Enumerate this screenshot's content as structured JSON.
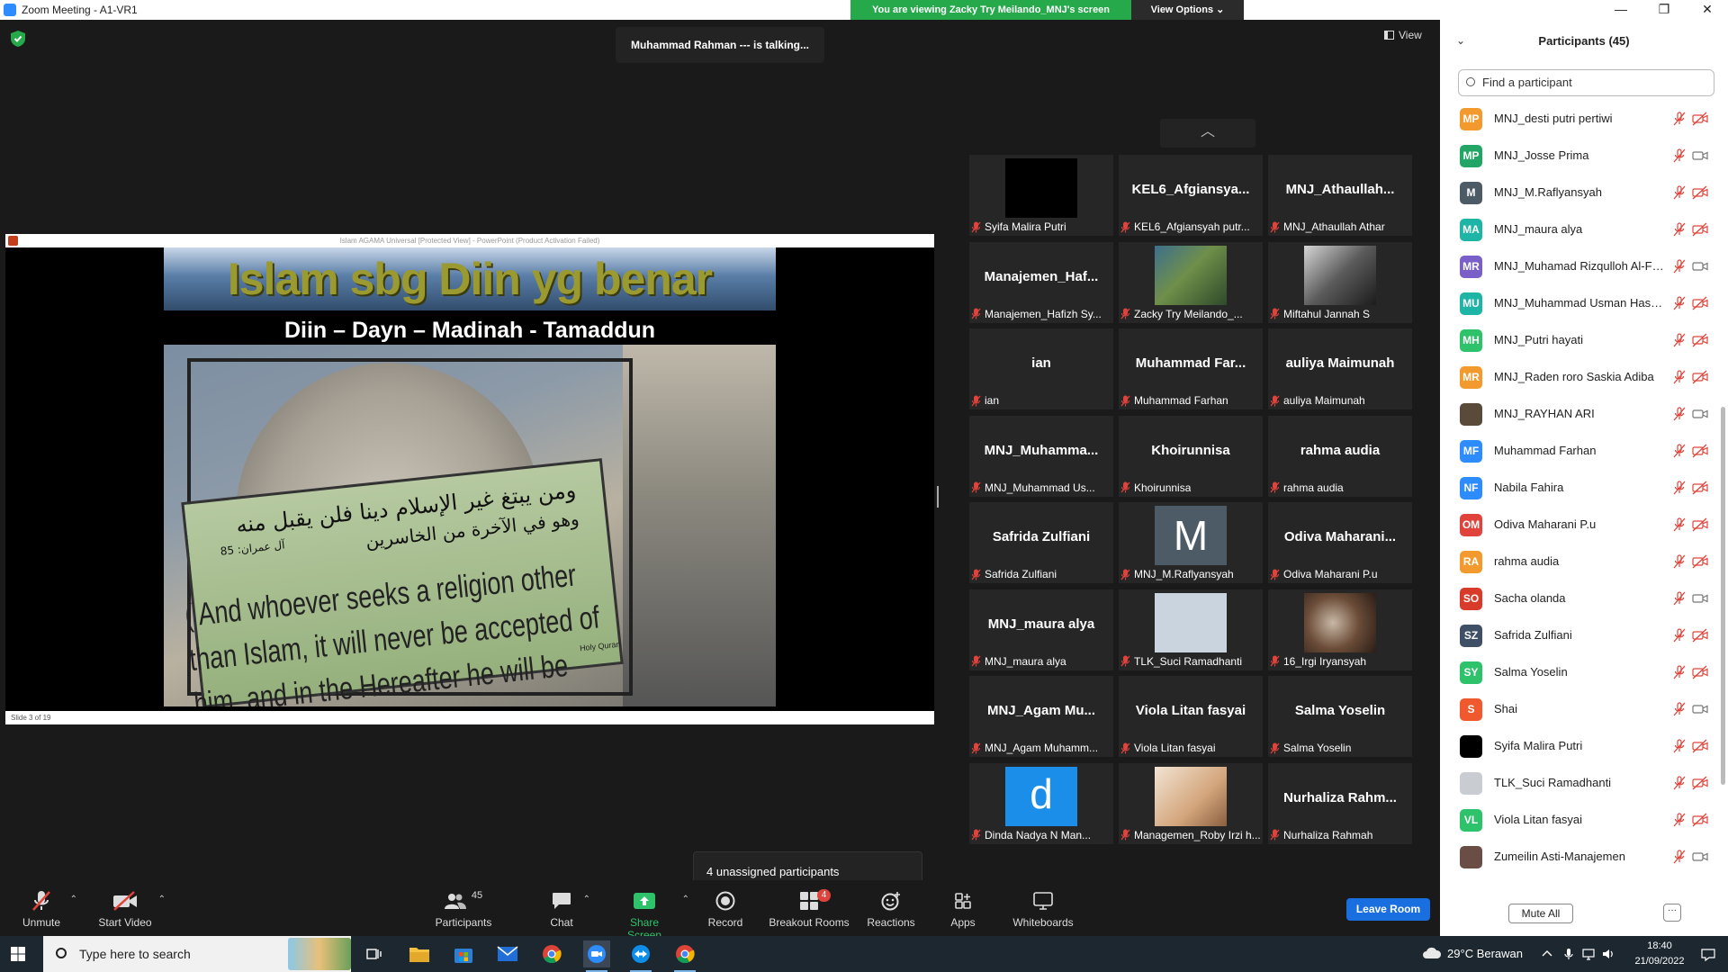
{
  "window": {
    "title": "Zoom Meeting - A1-VR1",
    "banner_text": "You are viewing Zacky Try Meilando_MNJ's screen",
    "view_options_label": "View Options ⌄",
    "controls": [
      "—",
      "❐",
      "✕"
    ]
  },
  "meeting": {
    "talking_text": "Muhammad Rahman --- is talking...",
    "view_label": "View",
    "unassigned_text": "4 unassigned participants"
  },
  "shared_screen": {
    "ppt_titlebar": "Islam AGAMA Universal [Protected View] - PowerPoint (Product Activation Failed)",
    "slide_status": "Slide 3 of 19",
    "slide_title": "Islam sbg Diin yg benar",
    "slide_subtitle": "Diin – Dayn – Madinah - Tamaddun",
    "arabic_line1": "ومن يبتغ غير الإسلام دينا فلن يقبل منه",
    "arabic_line2": "وهو في الآخرة من الخاسرين",
    "english_text": "( And whoever seeks a religion other than Islam, it will never be accepted of him, and in the Hereafter he will be one of the losers )",
    "sign_source": "Holy Quran",
    "verse_ref": "آل عمران: 85"
  },
  "gallery": {
    "tiles": [
      {
        "name": "",
        "caption": "Syifa Malira Putri",
        "pic": "black"
      },
      {
        "name": "KEL6_Afgiansya...",
        "caption": "KEL6_Afgiansyah putr...",
        "pic": ""
      },
      {
        "name": "MNJ_Athaullah...",
        "caption": "MNJ_Athaullah Athar",
        "pic": ""
      },
      {
        "name": "Manajemen_Haf...",
        "caption": "Manajemen_Hafizh Sy...",
        "pic": ""
      },
      {
        "name": "",
        "caption": "Zacky Try Meilando_...",
        "pic": "photo-green"
      },
      {
        "name": "",
        "caption": "Miftahul Jannah S",
        "pic": "photo-gray"
      },
      {
        "name": "ian",
        "caption": "ian",
        "pic": ""
      },
      {
        "name": "Muhammad Far...",
        "caption": "Muhammad Farhan",
        "pic": ""
      },
      {
        "name": "auliya Maimunah",
        "caption": "auliya Maimunah",
        "pic": ""
      },
      {
        "name": "MNJ_Muhamma...",
        "caption": "MNJ_Muhammad Us...",
        "pic": ""
      },
      {
        "name": "Khoirunnisa",
        "caption": "Khoirunnisa",
        "pic": ""
      },
      {
        "name": "rahma audia",
        "caption": "rahma audia",
        "pic": ""
      },
      {
        "name": "Safrida Zulfiani",
        "caption": "Safrida Zulfiani",
        "pic": ""
      },
      {
        "name": "",
        "caption": "MNJ_M.Raflyansyah",
        "pic": "letter-M"
      },
      {
        "name": "Odiva  Maharani...",
        "caption": "Odiva Maharani P.u",
        "pic": ""
      },
      {
        "name": "MNJ_maura alya",
        "caption": "MNJ_maura alya",
        "pic": ""
      },
      {
        "name": "",
        "caption": "TLK_Suci Ramadhanti",
        "pic": "light-blue"
      },
      {
        "name": "",
        "caption": "16_Irgi Iryansyah",
        "pic": "photo-brown"
      },
      {
        "name": "MNJ_Agam  Mu...",
        "caption": "MNJ_Agam Muhamm...",
        "pic": ""
      },
      {
        "name": "Viola Litan fasyai",
        "caption": "Viola Litan fasyai",
        "pic": ""
      },
      {
        "name": "Salma Yoselin",
        "caption": "Salma Yoselin",
        "pic": ""
      },
      {
        "name": "",
        "caption": "Dinda Nadya N Man...",
        "pic": "letter-d"
      },
      {
        "name": "",
        "caption": "Managemen_Roby Irzi h...",
        "pic": "photo-cream"
      },
      {
        "name": "Nurhaliza  Rahm...",
        "caption": "Nurhaliza Rahmah",
        "pic": ""
      }
    ],
    "pic_letters": {
      "letter-M": "M",
      "letter-d": "d"
    }
  },
  "toolbar": {
    "unmute": "Unmute",
    "start_video": "Start Video",
    "participants": "Participants",
    "participants_count": "45",
    "chat": "Chat",
    "share_screen": "Share Screen",
    "record": "Record",
    "breakout_rooms": "Breakout Rooms",
    "breakout_badge": "4",
    "reactions": "Reactions",
    "apps": "Apps",
    "whiteboards": "Whiteboards",
    "leave_room": "Leave Room"
  },
  "participants_panel": {
    "title": "Participants (45)",
    "search_placeholder": "Find a participant",
    "mute_all": "Mute All",
    "more_label": "···",
    "items": [
      {
        "initials": "MP",
        "color": "#f29a2e",
        "name": "MNJ_desti putri pertiwi",
        "video": "off"
      },
      {
        "initials": "MP",
        "color": "#23a566",
        "name": "MNJ_Josse Prima",
        "video": "on"
      },
      {
        "initials": "M",
        "color": "#4d5b67",
        "name": "MNJ_M.Raflyansyah",
        "video": "off"
      },
      {
        "initials": "MA",
        "color": "#1fb5a6",
        "name": "MNJ_maura alya",
        "video": "off"
      },
      {
        "initials": "MR",
        "color": "#7b5fc9",
        "name": "MNJ_Muhamad Rizqulloh Al-Fa...",
        "video": "on"
      },
      {
        "initials": "MU",
        "color": "#1fb5a6",
        "name": "MNJ_Muhammad Usman Hasa...",
        "video": "off"
      },
      {
        "initials": "MH",
        "color": "#2ec26b",
        "name": "MNJ_Putri hayati",
        "video": "off"
      },
      {
        "initials": "MR",
        "color": "#f29a2e",
        "name": "MNJ_Raden roro Saskia Adiba",
        "video": "off"
      },
      {
        "initials": "",
        "color": "#5a4a3a",
        "name": "MNJ_RAYHAN ARI",
        "video": "on"
      },
      {
        "initials": "MF",
        "color": "#2d8cff",
        "name": "Muhammad Farhan",
        "video": "off"
      },
      {
        "initials": "NF",
        "color": "#2d8cff",
        "name": "Nabila Fahira",
        "video": "off"
      },
      {
        "initials": "OM",
        "color": "#e0433b",
        "name": "Odiva Maharani P.u",
        "video": "off"
      },
      {
        "initials": "RA",
        "color": "#f29a2e",
        "name": "rahma audia",
        "video": "off"
      },
      {
        "initials": "SO",
        "color": "#d93b2b",
        "name": "Sacha olanda",
        "video": "on"
      },
      {
        "initials": "SZ",
        "color": "#3f4f66",
        "name": "Safrida Zulfiani",
        "video": "off"
      },
      {
        "initials": "SY",
        "color": "#2ec26b",
        "name": "Salma Yoselin",
        "video": "off"
      },
      {
        "initials": "S",
        "color": "#f0582d",
        "name": "Shai",
        "video": "on"
      },
      {
        "initials": "",
        "color": "#000000",
        "name": "Syifa Malira Putri",
        "video": "off"
      },
      {
        "initials": "",
        "color": "#c9ccd1",
        "name": "TLK_Suci Ramadhanti",
        "video": "off"
      },
      {
        "initials": "VL",
        "color": "#2ec26b",
        "name": "Viola Litan fasyai",
        "video": "off"
      },
      {
        "initials": "",
        "color": "#6a4e46",
        "name": "Zumeilin Asti-Manajemen",
        "video": "on"
      }
    ]
  },
  "taskbar": {
    "search_text": "Type here to search",
    "weather": "29°C  Berawan",
    "time": "18:40",
    "date": "21/09/2022",
    "apps": [
      "task-view",
      "file-explorer",
      "microsoft-store",
      "mail",
      "chrome",
      "zoom",
      "teamviewer",
      "chrome-alt"
    ]
  }
}
